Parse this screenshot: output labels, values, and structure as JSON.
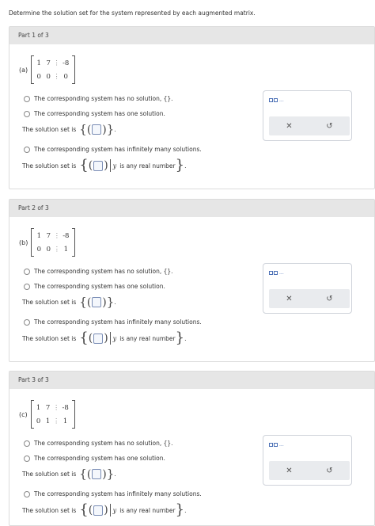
{
  "instruction": "Determine the solution set for the system represented by each augmented matrix.",
  "parts": [
    {
      "header": "Part 1 of 3",
      "label": "(a)",
      "matrix": [
        [
          "1",
          "7",
          "-8"
        ],
        [
          "0",
          "0",
          "0"
        ]
      ],
      "options": {
        "no_solution": "The corresponding system has no solution, {}.",
        "one_solution": "The corresponding system has one solution.",
        "infinite": "The corresponding system has infinitely many solutions."
      },
      "solution_set_label": "The solution set is",
      "any_real": "is any real number",
      "y_var": "y"
    },
    {
      "header": "Part 2 of 3",
      "label": "(b)",
      "matrix": [
        [
          "1",
          "7",
          "-8"
        ],
        [
          "0",
          "0",
          "1"
        ]
      ],
      "options": {
        "no_solution": "The corresponding system has no solution, {}.",
        "one_solution": "The corresponding system has one solution.",
        "infinite": "The corresponding system has infinitely many solutions."
      },
      "solution_set_label": "The solution set is",
      "any_real": "is any real number",
      "y_var": "y"
    },
    {
      "header": "Part 3 of 3",
      "label": "(c)",
      "matrix": [
        [
          "1",
          "7",
          "-8"
        ],
        [
          "0",
          "1",
          "1"
        ]
      ],
      "options": {
        "no_solution": "The corresponding system has no solution, {}.",
        "one_solution": "The corresponding system has one solution.",
        "infinite": "The corresponding system has infinitely many solutions."
      },
      "solution_set_label": "The solution set is",
      "any_real": "is any real number",
      "y_var": "y"
    }
  ],
  "tools": {
    "clear_icon": "✕",
    "undo_icon": "↺",
    "dots": "..."
  }
}
